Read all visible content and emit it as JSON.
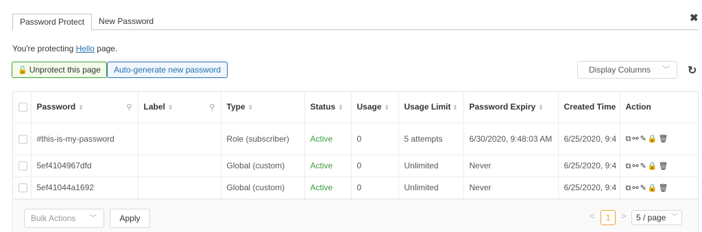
{
  "tabs": [
    {
      "label": "Password Protect",
      "active": true
    },
    {
      "label": "New Password",
      "active": false
    }
  ],
  "protect_line": {
    "prefix": "You're protecting ",
    "page_link": "Hello",
    "suffix": " page."
  },
  "buttons": {
    "unprotect": "Unprotect this page",
    "autogen": "Auto-generate new password"
  },
  "display_columns": {
    "label": "Display Columns"
  },
  "table": {
    "headers": [
      "Password",
      "Label",
      "Type",
      "Status",
      "Usage",
      "Usage Limit",
      "Password Expiry",
      "Created Time",
      "Action"
    ],
    "rows": [
      {
        "password": "#this-is-my-password",
        "label": "",
        "type": "Role (subscriber)",
        "status": "Active",
        "usage": "0",
        "limit": "5 attempts",
        "expiry": "6/30/2020, 9:48:03 AM",
        "created": "6/25/2020, 9:4"
      },
      {
        "password": "5ef4104967dfd",
        "label": "",
        "type": "Global (custom)",
        "status": "Active",
        "usage": "0",
        "limit": "Unlimited",
        "expiry": "Never",
        "created": "6/25/2020, 9:4"
      },
      {
        "password": "5ef41044a1692",
        "label": "",
        "type": "Global (custom)",
        "status": "Active",
        "usage": "0",
        "limit": "Unlimited",
        "expiry": "Never",
        "created": "6/25/2020, 9:4"
      }
    ]
  },
  "footer": {
    "bulk_actions": "Bulk Actions",
    "apply": "Apply",
    "current_page": "1",
    "per_page": "5 / page"
  },
  "colors": {
    "active_green": "#3a9c3a",
    "link_blue": "#2271b1",
    "page_orange": "#f0a030"
  }
}
